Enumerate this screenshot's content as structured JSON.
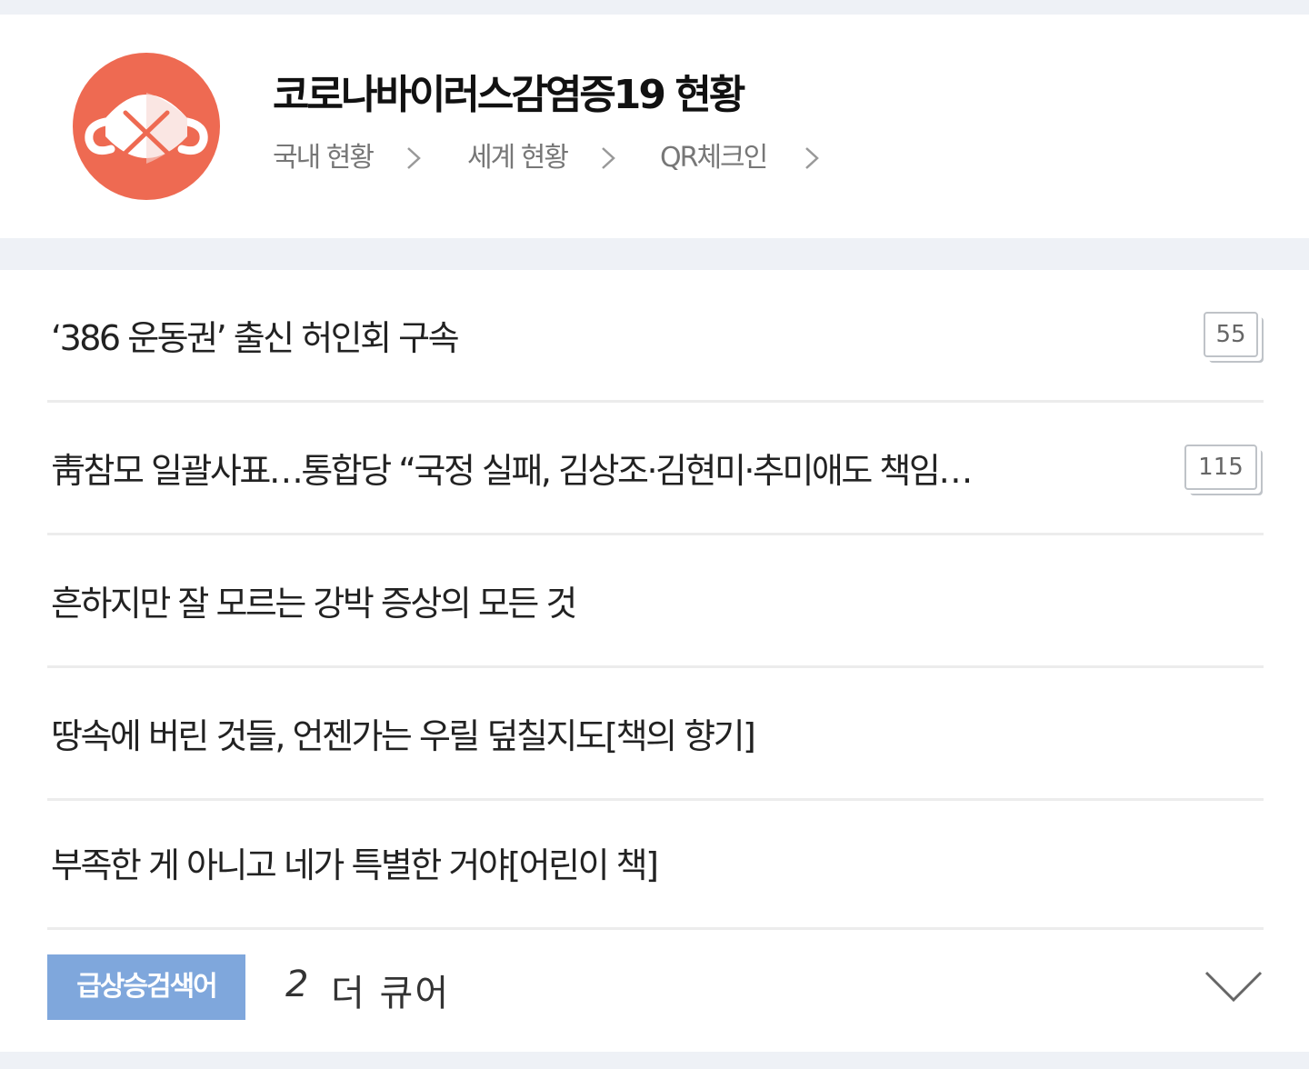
{
  "covid": {
    "title": "코로나바이러스감염증19 현황",
    "links": [
      {
        "label": "국내 현황"
      },
      {
        "label": "세계 현황"
      },
      {
        "label": "QR체크인"
      }
    ]
  },
  "news": [
    {
      "headline": "‘386 운동권’ 출신 허인회 구속",
      "comments": "55"
    },
    {
      "headline": "靑참모 일괄사표…통합당 “국정 실패, 김상조·김현미·추미애도 책임…",
      "comments": "115"
    },
    {
      "headline": "흔하지만 잘 모르는 강박 증상의 모든 것",
      "comments": null
    },
    {
      "headline": "땅속에 버린 것들, 언젠가는 우릴 덮칠지도[책의 향기]",
      "comments": null
    },
    {
      "headline": "부족한 게 아니고 네가 특별한 거야[어린이 책]",
      "comments": null
    }
  ],
  "trending": {
    "label": "급상승검색어",
    "rank": "2",
    "keyword": "더 큐어"
  },
  "colors": {
    "logo": "#ee6a52",
    "trend_badge": "#7fa7dc",
    "page_bg": "#eef1f6"
  },
  "icons": [
    "mask-icon",
    "chevron-right-icon",
    "chevron-down-icon"
  ]
}
